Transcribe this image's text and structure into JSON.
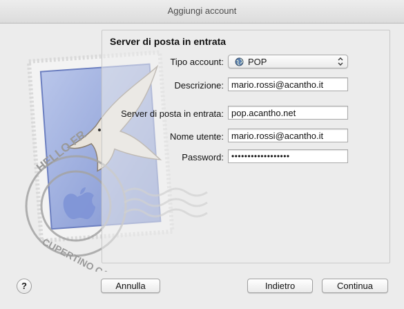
{
  "window": {
    "title": "Aggiungi account"
  },
  "panel": {
    "title": "Server di posta in entrata"
  },
  "form": {
    "account_type": {
      "label": "Tipo account:",
      "value": "POP"
    },
    "description": {
      "label": "Descrizione:",
      "value": "mario.rossi@acantho.it"
    },
    "incoming_server": {
      "label": "Server di posta in entrata:",
      "value": "pop.acantho.net"
    },
    "username": {
      "label": "Nome utente:",
      "value": "mario.rossi@acantho.it"
    },
    "password": {
      "label": "Password:",
      "value": "••••••••••••••••••"
    }
  },
  "stamp": {
    "text_top": "HELLO FR",
    "text_bottom": "CUPERTINO CA"
  },
  "buttons": {
    "help": "?",
    "cancel": "Annulla",
    "back": "Indietro",
    "continue": "Continua"
  }
}
